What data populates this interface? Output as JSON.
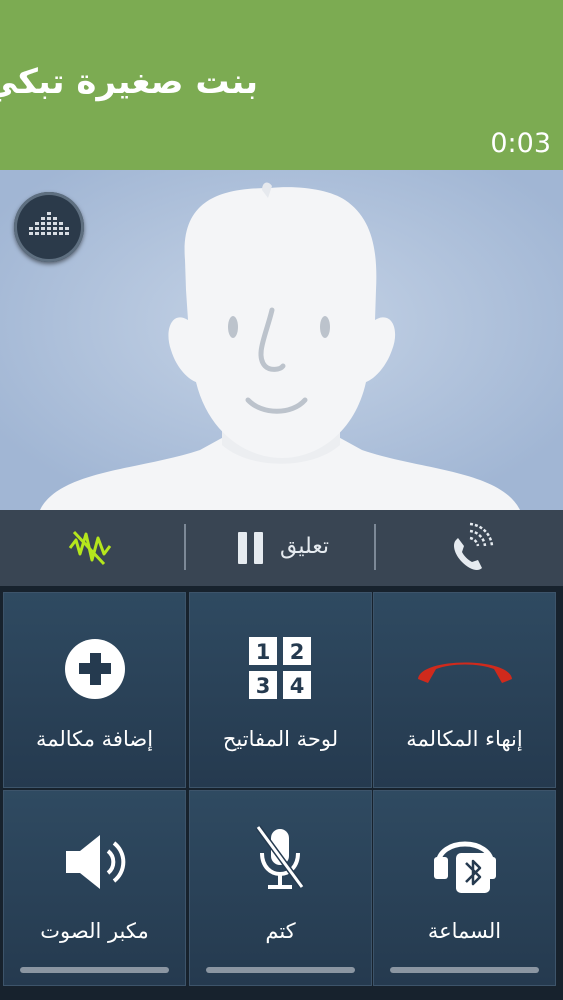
{
  "call": {
    "caller_name": "بنت صغيرة تبكي",
    "duration": "0:03"
  },
  "photo": {
    "avatar_icon": "default-contact-avatar-icon",
    "equalizer_icon": "equalizer-icon"
  },
  "options_bar": {
    "noise_icon": "noise-reduction-icon",
    "hold_icon": "pause-icon",
    "hold_label": "تعليق",
    "hd_call_icon": "phone-signal-icon"
  },
  "actions": [
    {
      "id": "add-call",
      "label": "إضافة مكالمة",
      "icon": "plus-circle-icon"
    },
    {
      "id": "keypad",
      "label": "لوحة المفاتيح",
      "icon": "keypad-icon",
      "keys": [
        "1",
        "2",
        "3",
        "4"
      ]
    },
    {
      "id": "end-call",
      "label": "إنهاء المكالمة",
      "icon": "end-call-icon"
    },
    {
      "id": "speaker",
      "label": "مكبر الصوت",
      "icon": "speaker-icon"
    },
    {
      "id": "mute",
      "label": "كتم",
      "icon": "mic-off-icon"
    },
    {
      "id": "headset",
      "label": "السماعة",
      "icon": "bluetooth-headset-icon"
    }
  ],
  "colors": {
    "header": "#7cab52",
    "photo_bg": "#a1b6d4",
    "end_call": "#d02a1c",
    "noise_active": "#b5e61d",
    "tile": "#2f4a61"
  }
}
